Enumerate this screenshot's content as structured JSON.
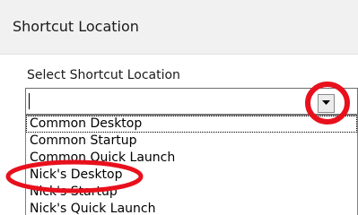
{
  "header": {
    "title": "Shortcut Location"
  },
  "form": {
    "label": "Select Shortcut Location",
    "value": ""
  },
  "dropdown": {
    "button_icon": "chevron-down-icon",
    "options": [
      "Common Desktop",
      "Common Startup",
      "Common Quick Launch",
      "Nick's Desktop",
      "Nick's Startup",
      "Nick's Quick Launch"
    ]
  },
  "annotations": {
    "highlight_color": "#e8101c",
    "highlighted_option": "Nick's Desktop"
  }
}
